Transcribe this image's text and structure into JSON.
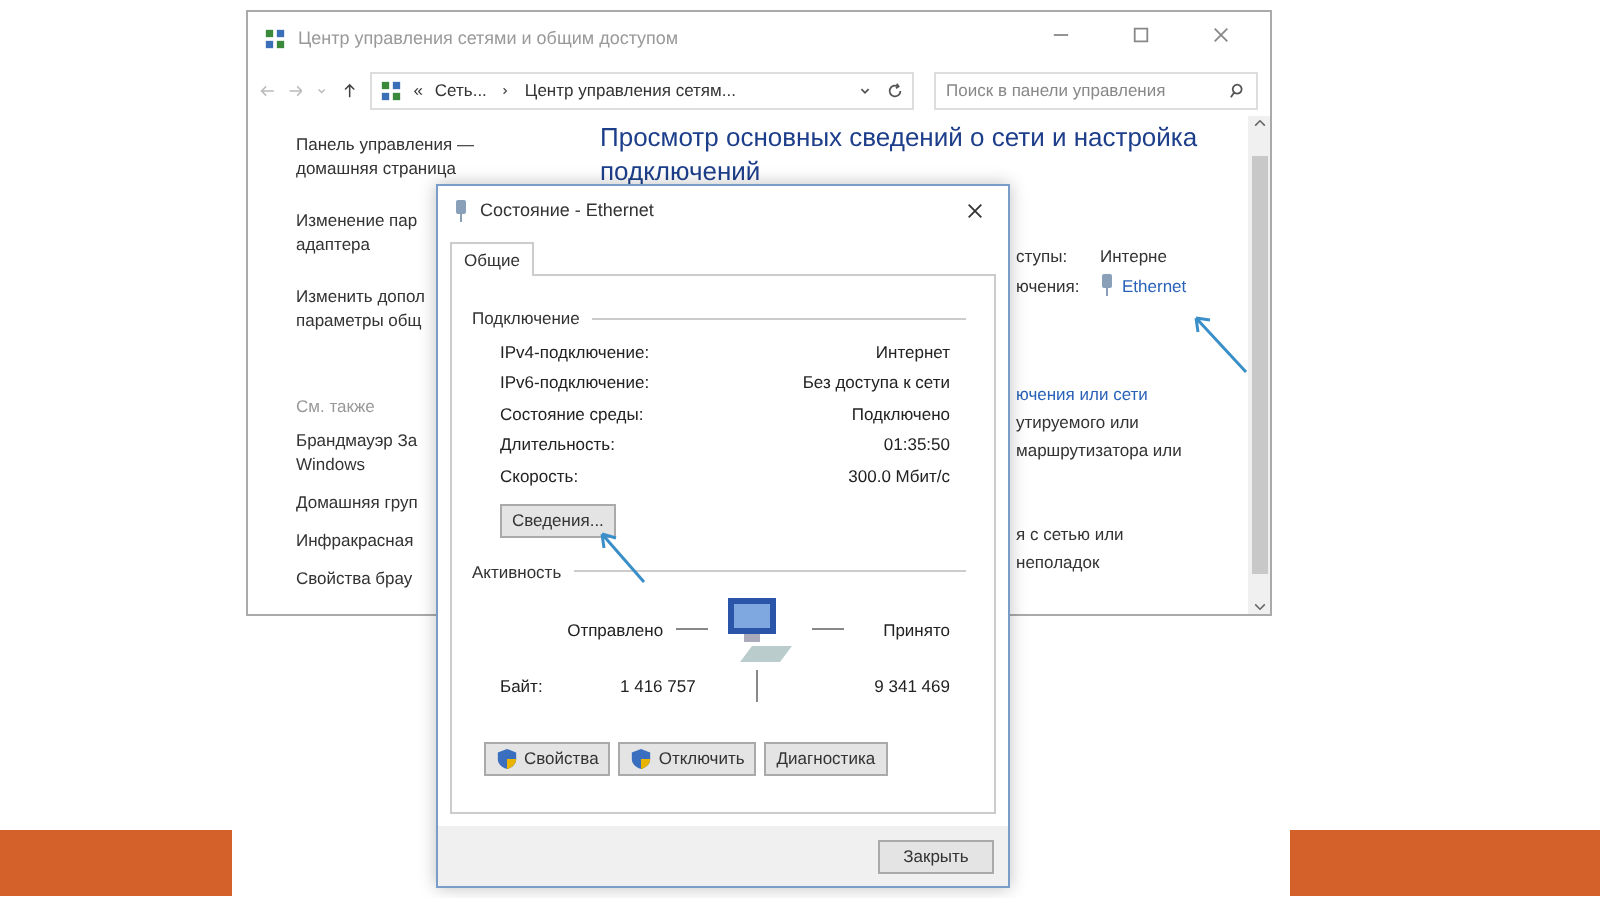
{
  "window": {
    "title": "Центр управления сетями и общим доступом",
    "breadcrumb": {
      "overflow": "«",
      "items": [
        "Сеть...",
        "Центр управления сетям..."
      ]
    },
    "search": {
      "placeholder": "Поиск в панели управления"
    },
    "sidebar": {
      "items": [
        {
          "lines": [
            "Панель управления —",
            "домашняя страница"
          ]
        },
        {
          "lines": [
            "Изменение пар",
            "адаптера"
          ]
        },
        {
          "lines": [
            "Изменить допол",
            "параметры общ"
          ]
        }
      ],
      "see_also_title": "См. также",
      "see_also": [
        {
          "lines": [
            "Брандмауэр За",
            "Windows"
          ]
        },
        {
          "lines": [
            "Домашняя груп"
          ]
        },
        {
          "lines": [
            "Инфракрасная"
          ]
        },
        {
          "lines": [
            "Свойства брау"
          ]
        }
      ]
    },
    "heading": "Просмотр основных сведений о сети и настройка подключений",
    "network_fragment": {
      "access_label": "ступы:",
      "access_value": "Интерне",
      "connections_label": "ючения:",
      "connection_link": "Ethernet"
    },
    "task_fragments": [
      {
        "kind": "link",
        "text": "ючения или сети"
      },
      {
        "kind": "text",
        "text": "утируемого или"
      },
      {
        "kind": "text",
        "text": "маршрутизатора или"
      },
      {
        "kind": "gap"
      },
      {
        "kind": "text",
        "text": "я с сетью или"
      },
      {
        "kind": "text",
        "text": "неполадок"
      }
    ]
  },
  "dialog": {
    "title": "Состояние - Ethernet",
    "tabs": [
      {
        "label": "Общие",
        "selected": true
      }
    ],
    "connection": {
      "title": "Подключение",
      "rows": [
        {
          "label": "IPv4-подключение:",
          "value": "Интернет"
        },
        {
          "label": "IPv6-подключение:",
          "value": "Без доступа к сети"
        },
        {
          "label": "Состояние среды:",
          "value": "Подключено"
        },
        {
          "label": "Длительность:",
          "value": "01:35:50"
        },
        {
          "label": "Скорость:",
          "value": "300.0 Мбит/с"
        }
      ],
      "details_button": "Сведения..."
    },
    "activity": {
      "title": "Активность",
      "sent_label": "Отправлено",
      "received_label": "Принято",
      "bytes_label": "Байт:",
      "sent": "1 416 757",
      "received": "9 341 469"
    },
    "buttons": [
      {
        "label": "Свойства",
        "kind": "shield"
      },
      {
        "label": "Отключить",
        "kind": "shield"
      },
      {
        "label": "Диагностика",
        "kind": "plain"
      }
    ],
    "close_button": "Закрыть"
  }
}
